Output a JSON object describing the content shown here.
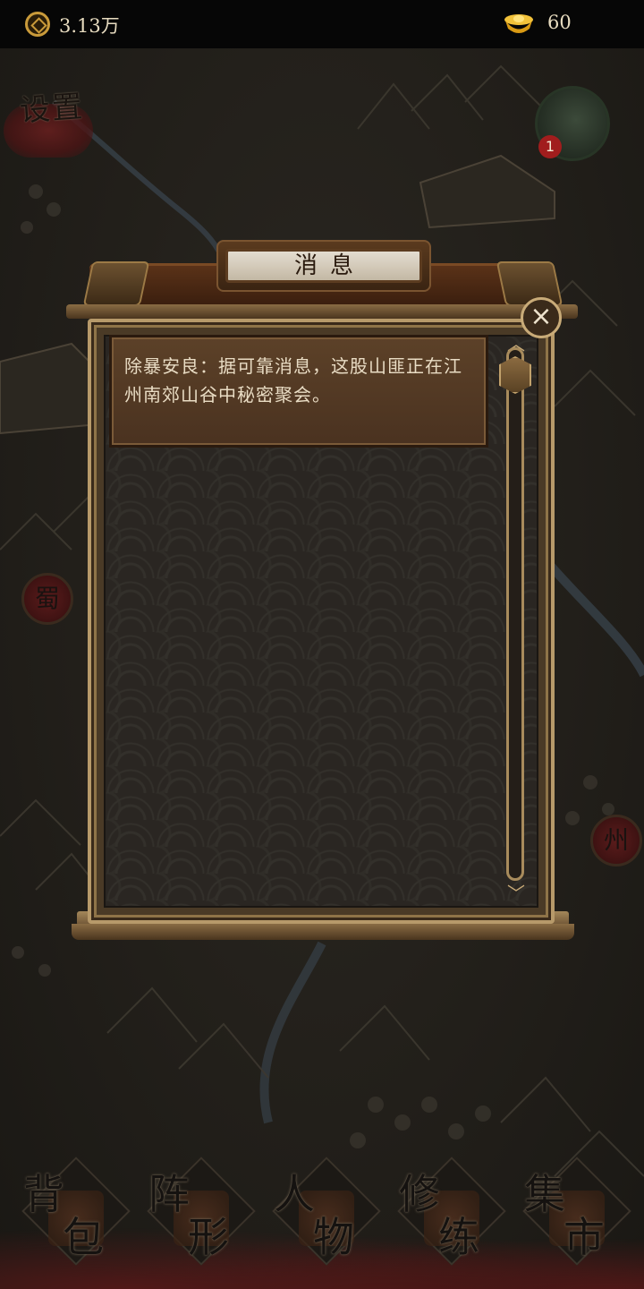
{
  "topbar": {
    "coin_icon": "copper-coin-icon",
    "coin_value": "3.13万",
    "ingot_icon": "gold-ingot-icon",
    "ingot_value": "60"
  },
  "map": {
    "settings_label": "设置",
    "avatar_badge": "1",
    "city_markers": [
      "蜀",
      "州"
    ]
  },
  "dialog": {
    "title": "消息",
    "messages": [
      "除暴安良：据可靠消息，这股山匪正在江州南郊山谷中秘密聚会。"
    ],
    "close_icon": "close-icon"
  },
  "nav": {
    "items": [
      {
        "label": "背包",
        "c1": "背",
        "c2": "包"
      },
      {
        "label": "阵形",
        "c1": "阵",
        "c2": "形"
      },
      {
        "label": "人物",
        "c1": "人",
        "c2": "物"
      },
      {
        "label": "修练",
        "c1": "修",
        "c2": "练"
      },
      {
        "label": "集市",
        "c1": "集",
        "c2": "市"
      }
    ]
  },
  "colors": {
    "frame_gold": "#b79a6a",
    "message_text": "#e9dcc4",
    "card_wood": "#5c4128",
    "badge_red": "#a11d1d"
  }
}
